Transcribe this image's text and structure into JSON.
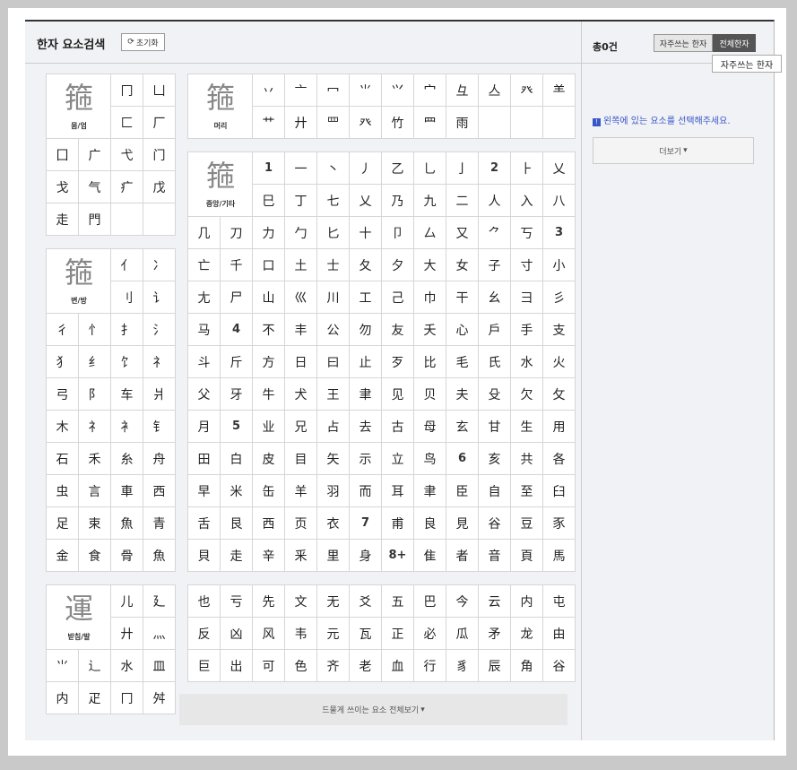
{
  "header": {
    "title": "한자 요소검색",
    "reset_label": "초기화"
  },
  "right": {
    "count_label": "총0건",
    "tab_frequent": "자주쓰는 한자",
    "tab_all": "전체한자",
    "tooltip": "자주쓰는 한자",
    "notice": "왼쪽에 있는 요소를 선택해주세요.",
    "more_label": "더보기"
  },
  "groups": {
    "outer": {
      "char": "箍",
      "label": "몸/엄",
      "chars": [
        "冂",
        "凵",
        "匚",
        "厂",
        "囗",
        "广",
        "弋",
        "门",
        "戈",
        "气",
        "疒",
        "戊",
        "走",
        "門",
        "",
        ""
      ]
    },
    "head": {
      "char": "箍",
      "label": "머리",
      "chars": [
        "丷",
        "亠",
        "冖",
        "⺌",
        "⺍",
        "宀",
        "彑",
        "亼",
        "癶",
        "⺷",
        "艹",
        "廾",
        "罒",
        "癶",
        "竹",
        "⺫",
        "雨",
        "",
        "",
        ""
      ]
    },
    "side": {
      "char": "箍",
      "label": "변/방",
      "chars": [
        "亻",
        "冫",
        "刂",
        "讠",
        "彳",
        "忄",
        "扌",
        "氵",
        "犭",
        "纟",
        "饣",
        "礻",
        "弓",
        "阝",
        "车",
        "爿",
        "木",
        "礻",
        "衤",
        "钅",
        "石",
        "禾",
        "糸",
        "舟",
        "虫",
        "言",
        "車",
        "西",
        "足",
        "束",
        "魚",
        "青",
        "金",
        "食",
        "骨",
        "魚"
      ]
    },
    "bottom": {
      "char": "運",
      "label": "받침/발",
      "chars": [
        "儿",
        "廴",
        "廾",
        "灬",
        "⺌",
        "辶",
        "水",
        "皿",
        "内",
        "疋",
        "冂",
        "舛"
      ]
    },
    "center": {
      "char": "箍",
      "label": "중앙/기타",
      "chars": [
        "1",
        "一",
        "丶",
        "丿",
        "乙",
        "乚",
        "亅",
        "2",
        "⺊",
        "乂",
        "巳",
        "丁",
        "七",
        "乂",
        "乃",
        "九",
        "二",
        "人",
        "入",
        "八",
        "几",
        "刀",
        "力",
        "勹",
        "匕",
        "十",
        "卩",
        "厶",
        "又",
        "⺈",
        "丂",
        "3",
        "亡",
        "千",
        "口",
        "土",
        "士",
        "夂",
        "夕",
        "大",
        "女",
        "子",
        "寸",
        "小",
        "尢",
        "尸",
        "山",
        "巛",
        "川",
        "工",
        "己",
        "巾",
        "干",
        "幺",
        "彐",
        "彡",
        "马",
        "4",
        "不",
        "丰",
        "公",
        "勿",
        "友",
        "夭",
        "心",
        "戶",
        "手",
        "支",
        "斗",
        "斤",
        "方",
        "日",
        "曰",
        "止",
        "歹",
        "比",
        "毛",
        "氏",
        "水",
        "火",
        "父",
        "牙",
        "牛",
        "犬",
        "王",
        "聿",
        "见",
        "贝",
        "夫",
        "殳",
        "欠",
        "攵",
        "月",
        "5",
        "业",
        "兄",
        "占",
        "去",
        "古",
        "母",
        "玄",
        "甘",
        "生",
        "用",
        "田",
        "白",
        "皮",
        "目",
        "矢",
        "示",
        "立",
        "鸟",
        "6",
        "亥",
        "共",
        "各",
        "早",
        "米",
        "缶",
        "羊",
        "羽",
        "而",
        "耳",
        "聿",
        "臣",
        "自",
        "至",
        "臼",
        "舌",
        "艮",
        "西",
        "页",
        "衣",
        "7",
        "甫",
        "良",
        "見",
        "谷",
        "豆",
        "豕",
        "貝",
        "走",
        "辛",
        "釆",
        "里",
        "身",
        "8+",
        "隹",
        "者",
        "音",
        "頁",
        "馬"
      ]
    },
    "extra": {
      "chars": [
        "也",
        "亏",
        "先",
        "文",
        "无",
        "爻",
        "五",
        "巴",
        "今",
        "云",
        "内",
        "屯",
        "反",
        "凶",
        "风",
        "韦",
        "元",
        "瓦",
        "正",
        "必",
        "瓜",
        "矛",
        "龙",
        "由",
        "巨",
        "出",
        "可",
        "色",
        "齐",
        "老",
        "血",
        "行",
        "豸",
        "辰",
        "角",
        "谷"
      ]
    }
  },
  "rare_label": "드물게 쓰이는 요소 전체보기"
}
